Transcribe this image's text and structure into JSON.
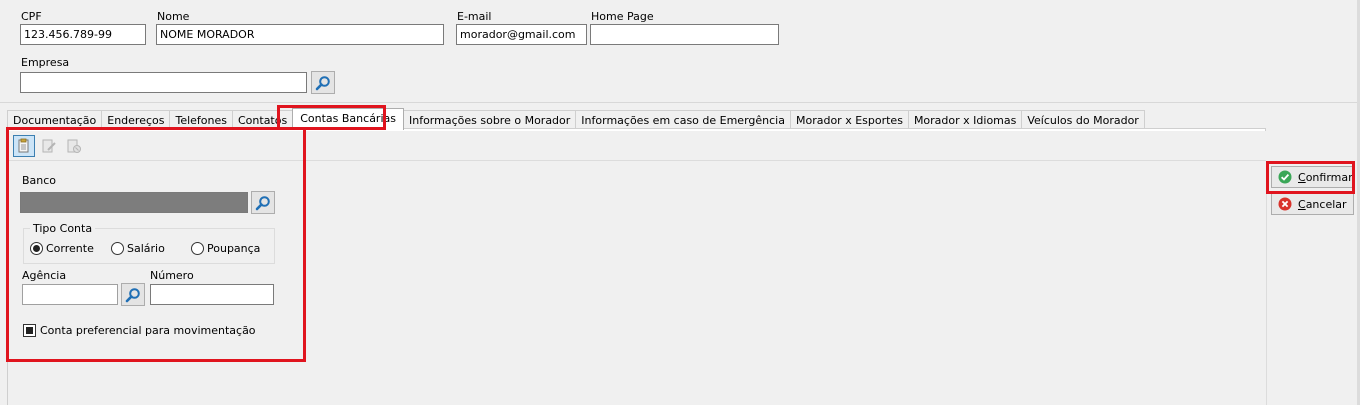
{
  "header": {
    "cpf_label": "CPF",
    "cpf_value": "123.456.789-99",
    "nome_label": "Nome",
    "nome_value": "NOME MORADOR",
    "email_label": "E-mail",
    "email_value": "morador@gmail.com",
    "homepage_label": "Home Page",
    "homepage_value": "",
    "empresa_label": "Empresa",
    "empresa_value": ""
  },
  "tabs": [
    {
      "label": "Documentação"
    },
    {
      "label": "Endereços"
    },
    {
      "label": "Telefones"
    },
    {
      "label": "Contatos"
    },
    {
      "label": "Contas Bancárias",
      "active": true
    },
    {
      "label": "Informações sobre o Morador"
    },
    {
      "label": "Informações em caso de Emergência"
    },
    {
      "label": "Morador x Esportes"
    },
    {
      "label": "Morador x Idiomas"
    },
    {
      "label": "Veículos do Morador"
    }
  ],
  "toolbar": {
    "icons": [
      "new-record-icon",
      "edit-record-icon",
      "delete-record-icon"
    ]
  },
  "form": {
    "banco_label": "Banco",
    "banco_value": "",
    "tipo_conta_label": "Tipo Conta",
    "tipo_conta_options": [
      "Corrente",
      "Salário",
      "Poupança"
    ],
    "tipo_conta_selected": "Corrente",
    "agencia_label": "Agência",
    "agencia_value": "",
    "numero_label": "Número",
    "numero_value": "",
    "preferencial_label": "Conta preferencial para movimentação",
    "preferencial_checked": true
  },
  "actions": {
    "confirmar_label": "Confirmar",
    "confirmar_hotkey": "C",
    "cancelar_label": "Cancelar",
    "cancelar_hotkey": "C"
  },
  "colors": {
    "highlight": "#e0141e",
    "confirm_icon": "#3aa757",
    "cancel_icon": "#d9322b",
    "search_icon": "#1f6fb5"
  }
}
